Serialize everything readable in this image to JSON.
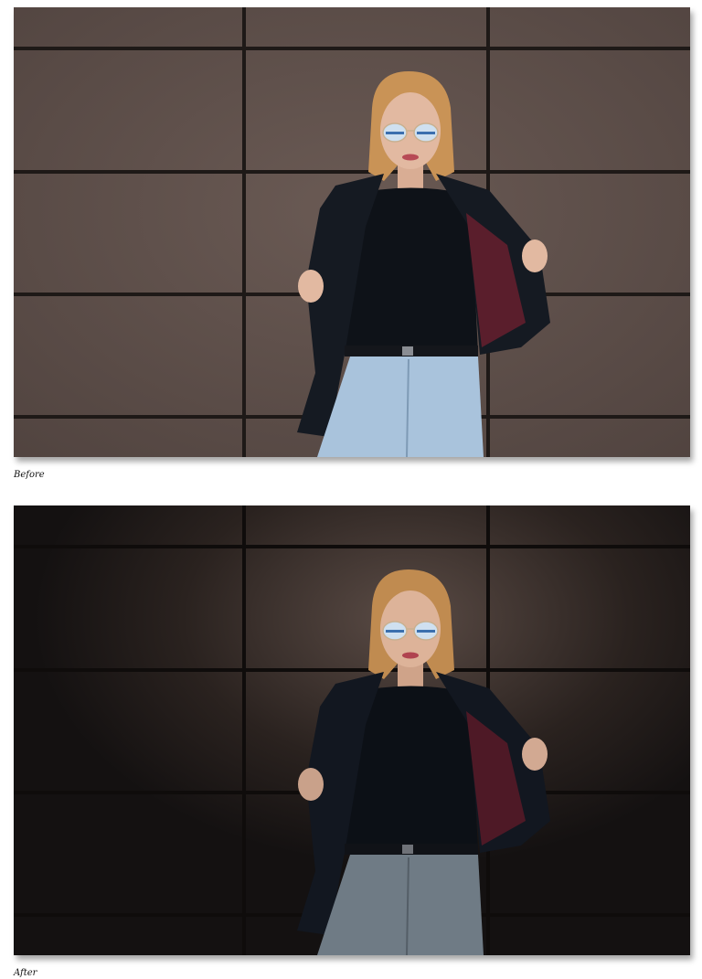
{
  "figure": {
    "before_caption": "Before",
    "after_caption": "After"
  },
  "colors": {
    "wall_before": "#5b4c47",
    "wall_after": "#2a221f",
    "grout": "#1e1917",
    "jacket": "#151a22",
    "shirt": "#0e1218",
    "jeans_before": "#a9c3dc",
    "jeans_after": "#6f7b85",
    "hair": "#c99356",
    "skin": "#e2b9a1",
    "lens": "#cfe0f0",
    "lining": "#5a1e2c"
  }
}
